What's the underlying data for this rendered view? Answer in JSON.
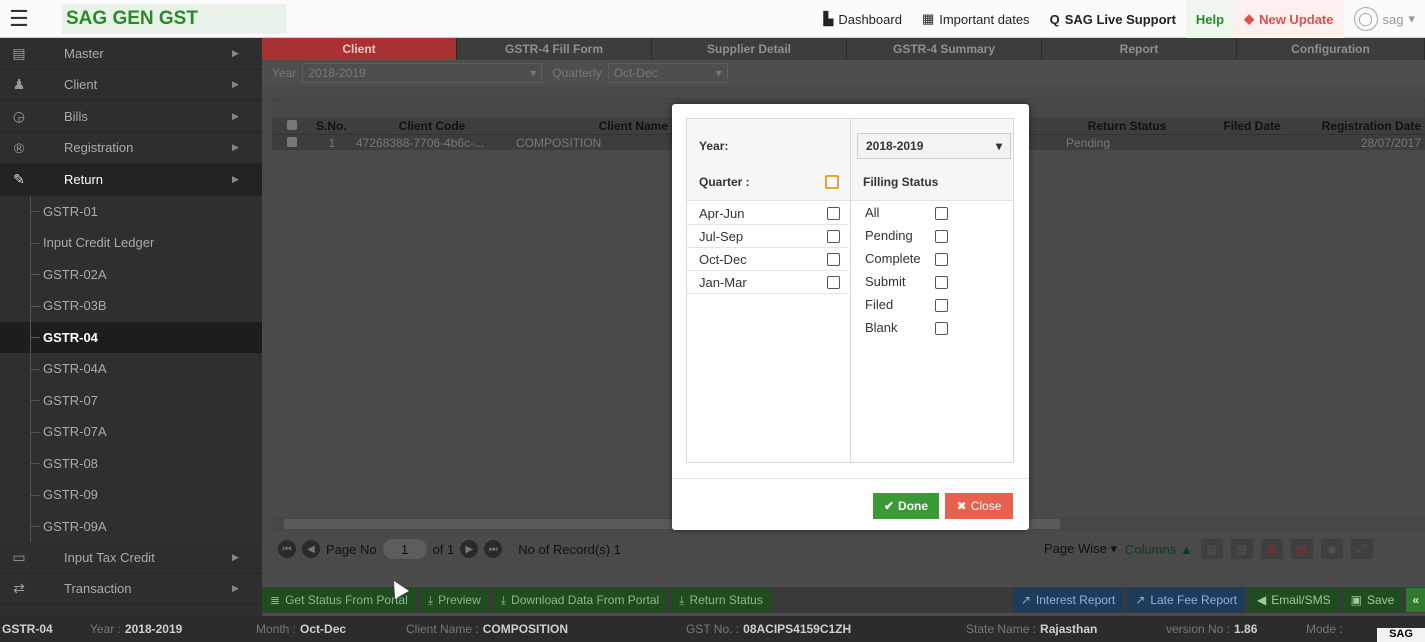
{
  "app": {
    "title": "SAG GEN GST"
  },
  "topnav": {
    "dashboard": "Dashboard",
    "important_dates": "Important dates",
    "live_support": "SAG Live Support",
    "help": "Help",
    "new_update": "New Update",
    "user": "sag"
  },
  "sidebar": {
    "items": [
      {
        "label": "Master",
        "icon": "database-icon"
      },
      {
        "label": "Client",
        "icon": "users-icon"
      },
      {
        "label": "Bills",
        "icon": "bills-icon"
      },
      {
        "label": "Registration",
        "icon": "registered-icon"
      },
      {
        "label": "Return",
        "icon": "edit-icon"
      }
    ],
    "return_sub": [
      "GSTR-01",
      "Input Credit Ledger",
      "GSTR-02A",
      "GSTR-03B",
      "GSTR-04",
      "GSTR-04A",
      "GSTR-07",
      "GSTR-07A",
      "GSTR-08",
      "GSTR-09",
      "GSTR-09A"
    ],
    "selected_sub": "GSTR-04",
    "bottom_items": [
      {
        "label": "Input Tax Credit",
        "icon": "credit-card-icon"
      },
      {
        "label": "Transaction",
        "icon": "exchange-icon"
      }
    ]
  },
  "tabs": [
    "Client",
    "GSTR-4 Fill Form",
    "Supplier Detail",
    "GSTR-4 Summary",
    "Report",
    "Configuration"
  ],
  "filter": {
    "year_label": "Year",
    "year_value": "2018-2019",
    "quarter_label": "Quarterly",
    "quarter_value": "Oct-Dec"
  },
  "grid": {
    "headers": [
      "S.No.",
      "Client Code",
      "Client Name",
      "Return Status",
      "Filed Date",
      "Registration Date"
    ],
    "row": {
      "sno": "1",
      "client_code": "47268388-7706-4b6c-...",
      "client_name": "COMPOSITION",
      "return_status": "Pending",
      "filed_date": "",
      "registration_date": "28/07/2017"
    }
  },
  "pager": {
    "page_label": "Page No",
    "page": "1",
    "of": "of 1",
    "records": "No of Record(s) 1",
    "page_wise": "Page Wise",
    "columns": "Columns"
  },
  "actions": [
    "Get Status From Portal",
    "Preview",
    "Download Data From Portal",
    "Return Status",
    "Interest Report",
    "Late Fee Report",
    "Email/SMS",
    "Save"
  ],
  "status": {
    "form": "GSTR-04",
    "year_label": "Year :",
    "year": "2018-2019",
    "month_label": "Month :",
    "month": "Oct-Dec",
    "client_label": "Client Name :",
    "client": "COMPOSITION",
    "gst_label": "GST No. :",
    "gst": "08ACIPS4159C1ZH",
    "state_label": "State Name :",
    "state": "Rajasthan",
    "version_label": "version No :",
    "version": "1.86",
    "mode_label": "Mode :",
    "mode_tag": "SAG"
  },
  "modal": {
    "year_label": "Year:",
    "year_value": "2018-2019",
    "quarter_label": "Quarter :",
    "filling_status_label": "Filling Status",
    "quarters": [
      "Apr-Jun",
      "Jul-Sep",
      "Oct-Dec",
      "Jan-Mar"
    ],
    "statuses": [
      "All",
      "Pending",
      "Complete",
      "Submit",
      "Filed",
      "Blank"
    ],
    "done": "Done",
    "close": "Close"
  }
}
